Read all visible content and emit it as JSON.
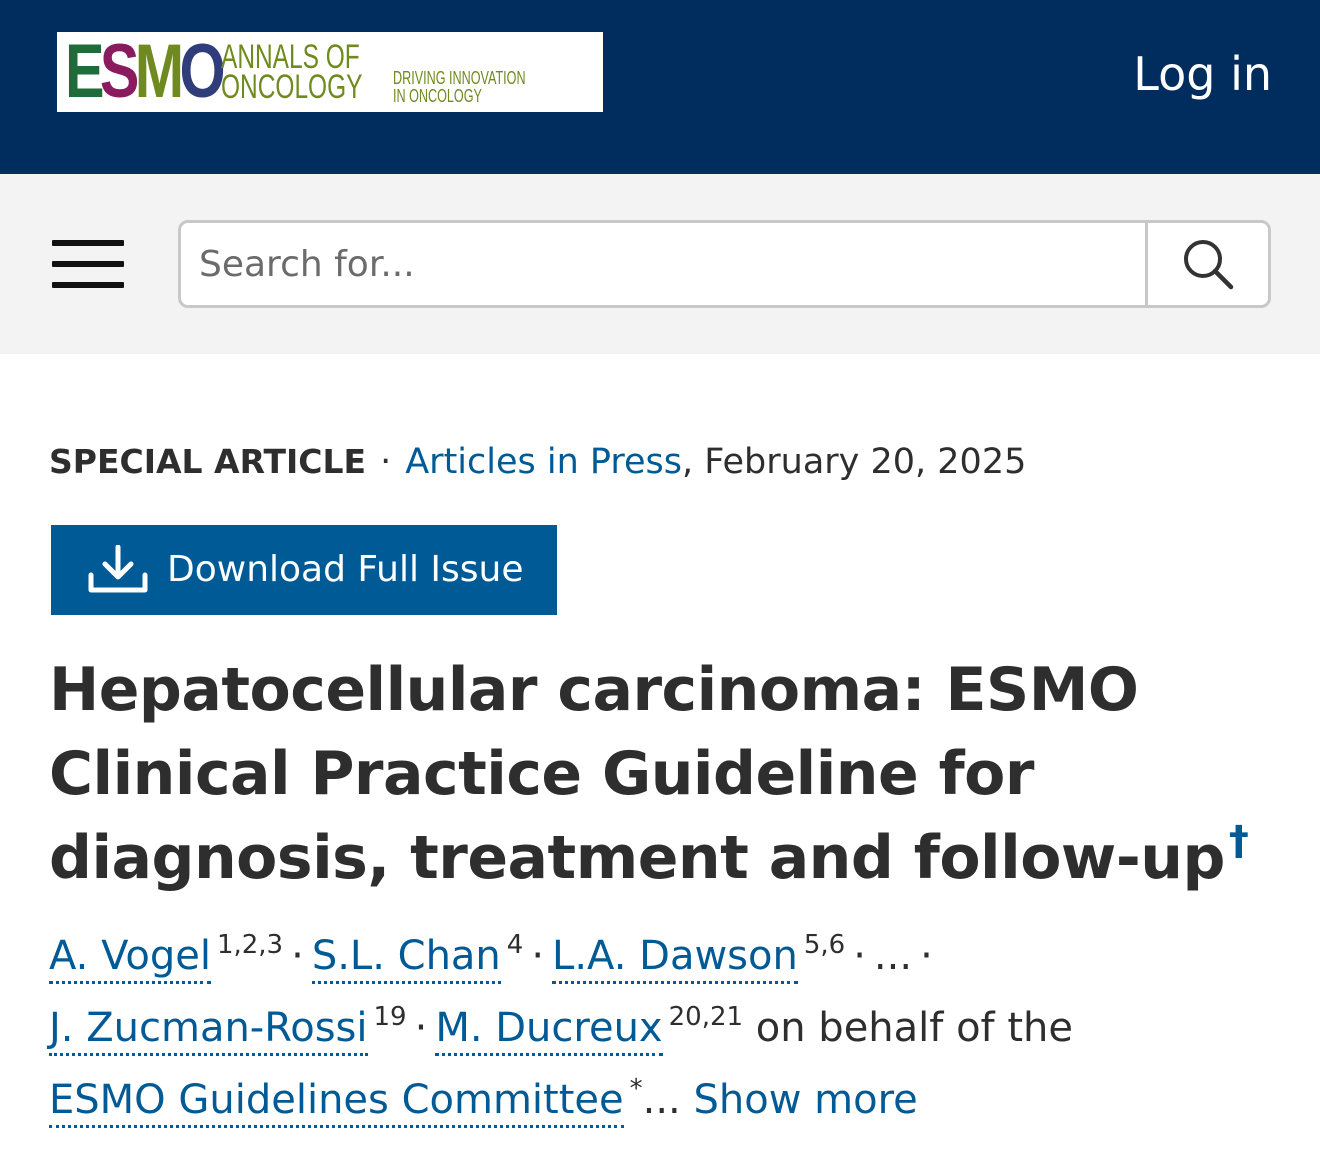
{
  "header": {
    "logo": {
      "wordmark": [
        "E",
        "S",
        "M",
        "O"
      ],
      "line1": "ANNALS OF",
      "line2": "ONCOLOGY",
      "tagline1": "DRIVING INNOVATION",
      "tagline2": "IN ONCOLOGY"
    },
    "login_label": "Log in"
  },
  "search": {
    "placeholder": "Search for..."
  },
  "article": {
    "type": "SPECIAL ARTICLE",
    "dot": "·",
    "issue_link": "Articles in Press",
    "date": ", February 20, 2025",
    "download_label": "Download Full Issue",
    "title": "Hepatocellular carcinoma: ESMO Clinical Practice Guideline for diagnosis, treatment and follow-up",
    "title_mark": "†",
    "authors": [
      {
        "name": "A. Vogel",
        "aff": "1,2,3"
      },
      {
        "name": "S.L. Chan",
        "aff": "4"
      },
      {
        "name": "L.A. Dawson",
        "aff": "5,6"
      },
      {
        "name": "J. Zucman-Rossi",
        "aff": "19"
      },
      {
        "name": "M. Ducreux",
        "aff": "20,21"
      }
    ],
    "ellipsis": "...",
    "on_behalf": "on behalf of the",
    "committee": "ESMO Guidelines Committee",
    "committee_mark": "*",
    "show_more_prefix": "...",
    "show_more": "Show more"
  },
  "colors": {
    "header_bg": "#002d5e",
    "link": "#005a96",
    "search_band": "#f3f3f3"
  }
}
